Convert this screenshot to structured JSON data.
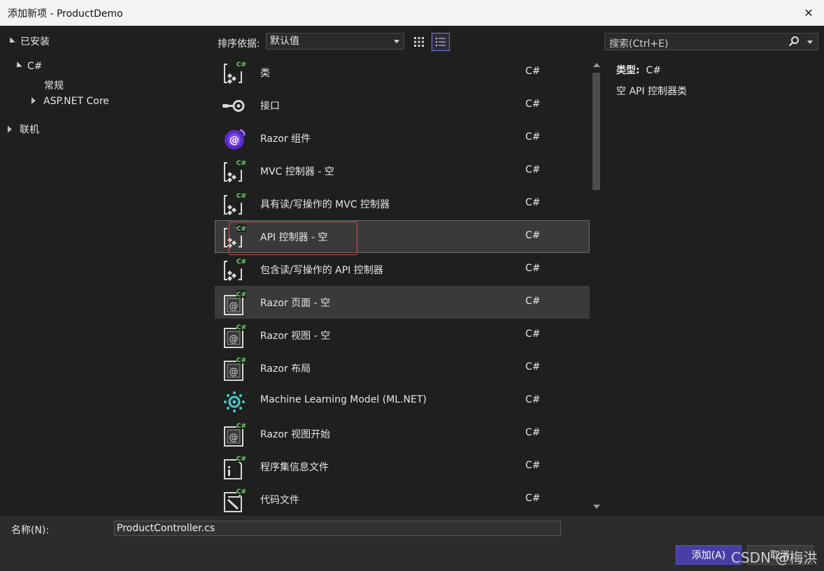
{
  "window": {
    "title": "添加新项 - ProductDemo",
    "close": "✕"
  },
  "tree": {
    "installed": "已安装",
    "csharp": "C#",
    "general": "常规",
    "aspnetcore": "ASP.NET Core",
    "online": "联机"
  },
  "sort": {
    "label": "排序依据:",
    "value": "默认值"
  },
  "search": {
    "placeholder": "搜索(Ctrl+E)"
  },
  "templates": [
    {
      "name": "类",
      "lang": "C#",
      "icon": "csharp-class-icon"
    },
    {
      "name": "接口",
      "lang": "C#",
      "icon": "interface-icon"
    },
    {
      "name": "Razor 组件",
      "lang": "C#",
      "icon": "blazor-icon"
    },
    {
      "name": "MVC 控制器 - 空",
      "lang": "C#",
      "icon": "controller-icon"
    },
    {
      "name": "具有读/写操作的 MVC 控制器",
      "lang": "C#",
      "icon": "controller-icon"
    },
    {
      "name": "API 控制器 - 空",
      "lang": "C#",
      "icon": "controller-icon"
    },
    {
      "name": "包含读/写操作的 API 控制器",
      "lang": "C#",
      "icon": "controller-icon"
    },
    {
      "name": "Razor 页面 - 空",
      "lang": "C#",
      "icon": "razor-page-icon"
    },
    {
      "name": "Razor 视图 - 空",
      "lang": "C#",
      "icon": "razor-page-icon"
    },
    {
      "name": "Razor 布局",
      "lang": "C#",
      "icon": "razor-page-icon"
    },
    {
      "name": "Machine Learning Model (ML.NET)",
      "lang": "C#",
      "icon": "ml-icon"
    },
    {
      "name": "Razor 视图开始",
      "lang": "C#",
      "icon": "razor-page-icon"
    },
    {
      "name": "程序集信息文件",
      "lang": "C#",
      "icon": "info-file-icon"
    },
    {
      "name": "代码文件",
      "lang": "C#",
      "icon": "code-file-icon"
    }
  ],
  "detail": {
    "type_label": "类型:",
    "type_value": "C#",
    "description": "空 API 控制器类"
  },
  "bottom": {
    "name_label": "名称(N):",
    "name_value": "ProductController.cs",
    "add": "添加(A)",
    "cancel": "取消"
  },
  "watermark": "CSDN @梅洪",
  "colors": {
    "accent": "#473fa5",
    "csharp_badge": "#6bd36b",
    "highlight": "#e0474c"
  }
}
